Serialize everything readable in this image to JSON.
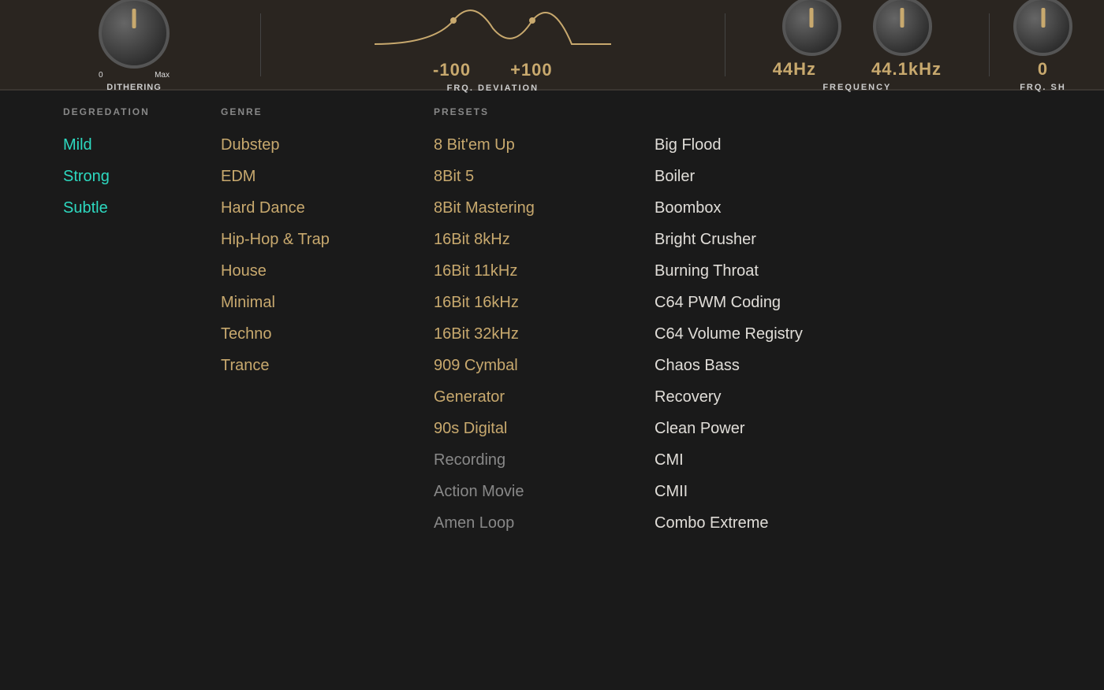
{
  "topPanel": {
    "dithering": {
      "minLabel": "0",
      "maxLabel": "Max",
      "paramLabel": "DITHERING"
    },
    "frqDeviation": {
      "minValue": "-100",
      "maxValue": "+100",
      "label": "FRQ. DEVIATION"
    },
    "frequency": {
      "value1": "44Hz",
      "value2": "44.1kHz",
      "label": "FREQUENCY"
    },
    "frqShift": {
      "label": "FRQ. SH"
    }
  },
  "sections": {
    "degradation": {
      "header": "DEGREDATION",
      "items": [
        {
          "label": "Mild",
          "color": "cyan"
        },
        {
          "label": "Strong",
          "color": "cyan"
        },
        {
          "label": "Subtle",
          "color": "cyan"
        }
      ]
    },
    "genre": {
      "header": "GENRE",
      "items": [
        {
          "label": "Dubstep",
          "color": "orange"
        },
        {
          "label": "EDM",
          "color": "orange"
        },
        {
          "label": "Hard Dance",
          "color": "orange"
        },
        {
          "label": "Hip-Hop & Trap",
          "color": "orange"
        },
        {
          "label": "House",
          "color": "orange"
        },
        {
          "label": "Minimal",
          "color": "orange"
        },
        {
          "label": "Techno",
          "color": "orange"
        },
        {
          "label": "Trance",
          "color": "orange"
        }
      ]
    },
    "presets": {
      "header": "PRESETS",
      "col1": [
        {
          "label": "8 Bit'em Up",
          "color": "orange"
        },
        {
          "label": "8Bit 5",
          "color": "orange"
        },
        {
          "label": "8Bit Mastering",
          "color": "orange"
        },
        {
          "label": "16Bit 8kHz",
          "color": "orange"
        },
        {
          "label": "16Bit 11kHz",
          "color": "orange"
        },
        {
          "label": "16Bit 16kHz",
          "color": "orange"
        },
        {
          "label": "16Bit 32kHz",
          "color": "orange"
        },
        {
          "label": "909 Cymbal",
          "color": "orange"
        },
        {
          "label": "Generator",
          "color": "orange"
        },
        {
          "label": "90s Digital",
          "color": "orange"
        },
        {
          "label": "Recording",
          "color": "gray"
        },
        {
          "label": "Action Movie",
          "color": "gray"
        },
        {
          "label": "Amen Loop",
          "color": "gray"
        }
      ],
      "col2": [
        {
          "label": "Big Flood",
          "color": "white"
        },
        {
          "label": "Boiler",
          "color": "white"
        },
        {
          "label": "Boombox",
          "color": "white"
        },
        {
          "label": "Bright Crusher",
          "color": "white"
        },
        {
          "label": "Burning Throat",
          "color": "white"
        },
        {
          "label": "C64 PWM Coding",
          "color": "white"
        },
        {
          "label": "C64 Volume Registry",
          "color": "white"
        },
        {
          "label": "Chaos Bass",
          "color": "white"
        },
        {
          "label": "Recovery",
          "color": "white"
        },
        {
          "label": "Clean Power",
          "color": "white"
        },
        {
          "label": "CMI",
          "color": "white"
        },
        {
          "label": "CMII",
          "color": "white"
        },
        {
          "label": "Combo Extreme",
          "color": "white"
        }
      ]
    }
  }
}
